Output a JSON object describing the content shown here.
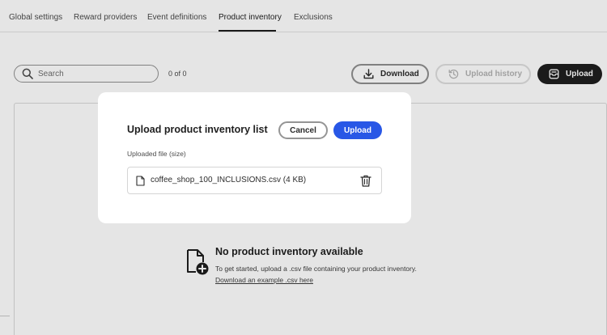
{
  "tabs": [
    {
      "label": "Global settings"
    },
    {
      "label": "Reward providers"
    },
    {
      "label": "Event definitions"
    },
    {
      "label": "Product inventory"
    },
    {
      "label": "Exclusions"
    }
  ],
  "active_tab": "Product inventory",
  "search": {
    "placeholder": "Search",
    "icon": "search-icon"
  },
  "count": "0 of 0",
  "toolbar": {
    "download_label": "Download",
    "upload_history_label": "Upload history",
    "upload_label": "Upload"
  },
  "empty_state": {
    "title": "No product inventory available",
    "description": "To get started, upload a .csv file containing your product inventory.",
    "link": "Download an example .csv here"
  },
  "dialog": {
    "title": "Upload product inventory list",
    "cancel_label": "Cancel",
    "upload_label": "Upload",
    "file_label": "Uploaded file (size)",
    "file_name": "coffee_shop_100_INCLUSIONS.csv (4 KB)"
  },
  "colors": {
    "primary": "#2857e6",
    "dark_button": "#1f1f1f",
    "text": "#222222"
  }
}
